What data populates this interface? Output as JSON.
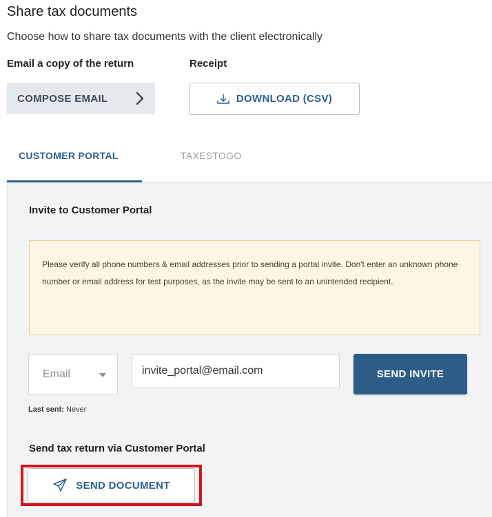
{
  "header": {
    "title": "Share tax documents",
    "subtitle": "Choose how to share tax documents with the client electronically"
  },
  "email_section": {
    "label": "Email a copy of the return",
    "button_label": "COMPOSE EMAIL"
  },
  "receipt_section": {
    "label": "Receipt",
    "button_label": "DOWNLOAD (CSV)"
  },
  "tabs": [
    {
      "label": "CUSTOMER PORTAL",
      "active": true
    },
    {
      "label": "TAXESTOGO",
      "active": false
    }
  ],
  "portal": {
    "invite_title": "Invite to Customer Portal",
    "warning_text": "Please verify all phone numbers & email addresses prior to sending a portal invite. Don't enter an unknown phone number or email address for test purposes, as the invite may be sent to an unintended recipient.",
    "contact_type": "Email",
    "email_value": "invite_portal@email.com",
    "send_invite_label": "SEND INVITE",
    "last_sent_label": "Last sent:",
    "last_sent_value": "Never",
    "send_return_title": "Send tax return via Customer Portal",
    "send_document_label": "SEND DOCUMENT"
  },
  "colors": {
    "primary": "#2d5d86",
    "highlight": "#d1151d",
    "warning_bg": "#fdf6e7",
    "warning_border": "#f0cf8e"
  },
  "icons": {
    "compose": "chevron-right-icon",
    "download": "download-icon",
    "contact_select": "caret-down-icon",
    "send_document": "paper-plane-icon"
  }
}
